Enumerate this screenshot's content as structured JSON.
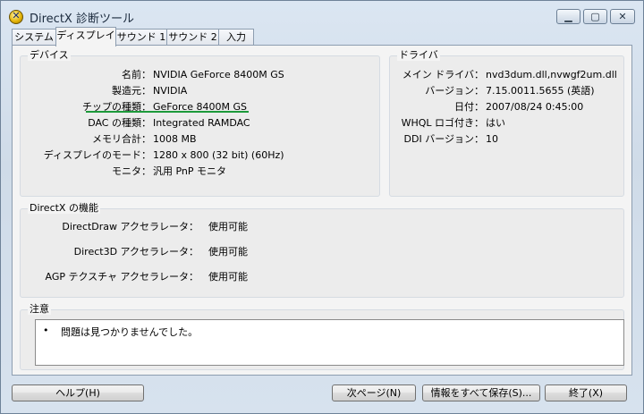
{
  "window": {
    "title": "DirectX 診断ツール",
    "icon": "directx-icon",
    "controls": {
      "minimize": "▁",
      "maximize": "▢",
      "close": "✕"
    }
  },
  "tabs": [
    {
      "label": "システム",
      "active": false
    },
    {
      "label": "ディスプレイ",
      "active": true
    },
    {
      "label": "サウンド 1",
      "active": false
    },
    {
      "label": "サウンド 2",
      "active": false
    },
    {
      "label": "入力",
      "active": false
    }
  ],
  "device": {
    "title": "デバイス",
    "rows": [
      {
        "label": "名前：",
        "value": "NVIDIA GeForce 8400M GS"
      },
      {
        "label": "製造元：",
        "value": "NVIDIA"
      },
      {
        "label": "チップの種類：",
        "value": "GeForce 8400M GS"
      },
      {
        "label": "DAC の種類：",
        "value": "Integrated RAMDAC"
      },
      {
        "label": "メモリ合計：",
        "value": "1008 MB"
      },
      {
        "label": "ディスプレイのモード：",
        "value": "1280 x 800 (32 bit) (60Hz)"
      },
      {
        "label": "モニタ：",
        "value": "汎用 PnP モニタ"
      }
    ]
  },
  "driver": {
    "title": "ドライバ",
    "rows": [
      {
        "label": "メイン ドライバ：",
        "value": "nvd3dum.dll,nvwgf2um.dll"
      },
      {
        "label": "バージョン：",
        "value": "7.15.0011.5655 (英語)"
      },
      {
        "label": "日付：",
        "value": "2007/08/24 0:45:00"
      },
      {
        "label": "WHQL ロゴ付き：",
        "value": "はい"
      },
      {
        "label": "DDI バージョン：",
        "value": "10"
      }
    ]
  },
  "directx": {
    "title": "DirectX の機能",
    "rows": [
      {
        "label": "DirectDraw アクセラレータ：",
        "value": "使用可能"
      },
      {
        "label": "Direct3D アクセラレータ：",
        "value": "使用可能"
      },
      {
        "label": "AGP テクスチャ アクセラレータ：",
        "value": "使用可能"
      }
    ]
  },
  "notes": {
    "title": "注意",
    "bullet": "•",
    "items": [
      "問題は見つかりませんでした。"
    ]
  },
  "buttons": {
    "help": "ヘルプ(H)",
    "next_page": "次ページ(N)",
    "save_all": "情報をすべて保存(S)...",
    "exit": "終了(X)"
  }
}
